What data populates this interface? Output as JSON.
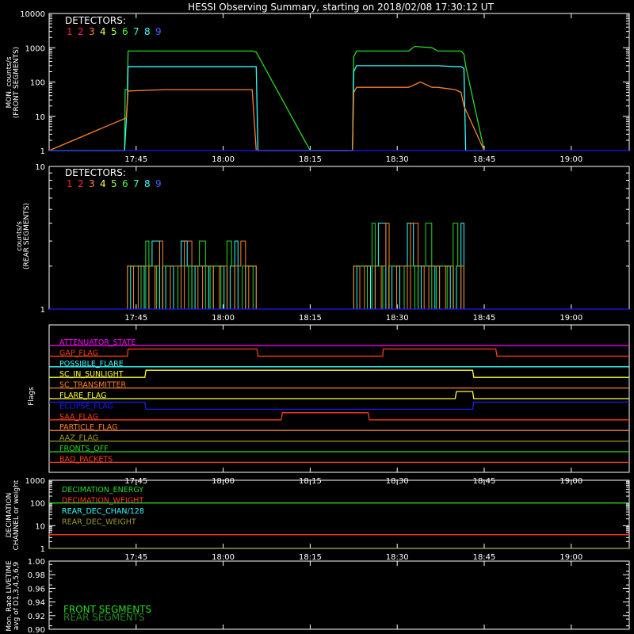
{
  "title": "HESSI Observing Summary, starting on 2018/02/08 17:30:12 UT",
  "time_ticks": [
    "17:45",
    "18:00",
    "18:15",
    "18:30",
    "18:45",
    "19:00"
  ],
  "detector_digits": [
    "1",
    "2",
    "3",
    "4",
    "5",
    "6",
    "7",
    "8",
    "9"
  ],
  "colors": {
    "det": [
      "#ff2020",
      "#ff2060",
      "#ff8040",
      "#ffff40",
      "#a0ff40",
      "#40ff40",
      "#40ffc0",
      "#40ffff",
      "#4060ff"
    ],
    "green": "#22dd22",
    "cyan": "#33ffff",
    "orange": "#ff7f2a",
    "blue": "#1a1aff",
    "magenta": "#ff00ff",
    "red": "#ff3a1a",
    "yellow": "#ffff2a",
    "olive": "#9a9a2a",
    "dkgreen": "#228822",
    "white": "#ffffff"
  },
  "panel1": {
    "ylabel": "MON. counts/s",
    "ylabel2": "(FRONT SEGMENTS)",
    "legend_title": "DETECTORS:",
    "yticks": [
      "1",
      "10",
      "100",
      "1000",
      "10000"
    ]
  },
  "panel2": {
    "ylabel": "counts/s",
    "ylabel2": "(REAR SEGMENTS)",
    "legend_title": "DETECTORS:",
    "yticks": [
      "1",
      "10"
    ]
  },
  "panel3": {
    "ylabel": "Flags",
    "flags": [
      "ATTENUATOR_STATE",
      "GAP_FLAG",
      "POSSIBLE_FLARE",
      "SC_IN_SUNLIGHT",
      "SC_TRANSMITTER",
      "FLARE_FLAG",
      "ECLIPSE_FLAG",
      "SAA_FLAG",
      "PARTICLE_FLAG",
      "AAZ_FLAG",
      "FRONTS_OFF",
      "BAD_PACKETS"
    ]
  },
  "panel4": {
    "ylabel": "DECIMATION",
    "ylabel2": "CHANNEL or weight",
    "yticks": [
      "1",
      "10",
      "100",
      "1000"
    ],
    "legend": [
      "DECIMATION_ENERGY",
      "DECIMATION_WEIGHT",
      "REAR_DEC_CHAN/128",
      "REAR_DEC_WEIGHT"
    ]
  },
  "panel5": {
    "ylabel": "Mon. Rate LIVETIME",
    "ylabel2": "avg of D1,3,4,5,6,9",
    "yticks": [
      "0.90",
      "0.92",
      "0.94",
      "0.96",
      "0.98",
      "1.00"
    ],
    "legend": [
      "FRONT SEGMENTS",
      "REAR SEGMENTS"
    ]
  },
  "chart_data": [
    {
      "type": "line",
      "title": "HESSI Observing Summary, starting on 2018/02/08 17:30:12 UT",
      "ylabel": "MON. counts/s (FRONT SEGMENTS)",
      "yscale": "log",
      "ylim": [
        1,
        10000
      ],
      "x_unit": "minutes after 17:30 UT",
      "xlim": [
        0,
        100
      ],
      "series": [
        {
          "color": "green",
          "x": [
            0,
            13,
            13.1,
            13.5,
            13.6,
            35,
            35.7,
            45,
            46,
            52.3,
            52.5,
            53,
            60,
            62,
            63,
            66,
            67,
            71,
            71.5,
            71.8,
            75
          ],
          "y": [
            1,
            1,
            60,
            60,
            800,
            800,
            750,
            1,
            1,
            1,
            550,
            800,
            800,
            800,
            1100,
            1000,
            800,
            800,
            650,
            300,
            1
          ]
        },
        {
          "color": "cyan",
          "x": [
            0,
            13,
            13.5,
            13.6,
            35,
            35.7,
            36,
            46,
            52.3,
            52.5,
            53,
            66,
            67,
            70,
            71,
            71.5,
            71.8,
            75
          ],
          "y": [
            1,
            1,
            30,
            280,
            280,
            280,
            1,
            1,
            1,
            200,
            300,
            300,
            300,
            280,
            280,
            250,
            1,
            1
          ]
        },
        {
          "color": "orange",
          "x": [
            0,
            13.3,
            13.6,
            14,
            20,
            26,
            30,
            35,
            35.7,
            46,
            52.3,
            52.5,
            53,
            56,
            62,
            64,
            66,
            67,
            70,
            71,
            71.5,
            75
          ],
          "y": [
            1,
            9,
            55,
            55,
            60,
            60,
            60,
            60,
            1,
            1,
            1,
            50,
            70,
            70,
            70,
            100,
            70,
            70,
            60,
            50,
            20,
            1
          ]
        },
        {
          "color": "blue",
          "x": [
            0,
            100
          ],
          "y": [
            1,
            1
          ]
        }
      ]
    },
    {
      "type": "line",
      "ylabel": "counts/s (REAR SEGMENTS)",
      "yscale": "log",
      "ylim": [
        1,
        10
      ],
      "x_unit": "minutes after 17:30 UT",
      "xlim": [
        0,
        100
      ],
      "series": [
        {
          "color": "cyan",
          "x": [
            0,
            13.5,
            13.6,
            35,
            35.7,
            52.5,
            52.7,
            71.5,
            72,
            100
          ],
          "y": [
            1,
            1,
            2,
            3,
            1,
            1,
            4,
            3,
            1,
            1
          ]
        },
        {
          "color": "green",
          "x": [
            0,
            14,
            14.1,
            34,
            35,
            52.7,
            53,
            70,
            71,
            100
          ],
          "y": [
            1,
            1,
            2,
            2,
            1,
            1,
            3,
            2,
            1,
            1
          ]
        },
        {
          "color": "orange",
          "x": [
            0,
            14,
            14.1,
            34,
            35,
            52.7,
            53,
            70,
            71,
            100
          ],
          "y": [
            1,
            1,
            2,
            2,
            1,
            1,
            3,
            2,
            1,
            1
          ]
        }
      ]
    },
    {
      "type": "line",
      "ylabel": "Flags",
      "x_unit": "minutes after 17:30 UT",
      "xlim": [
        0,
        100
      ],
      "series": [
        {
          "name": "ATTENUATOR_STATE",
          "color": "magenta",
          "x": [
            0,
            100
          ],
          "y": [
            0,
            0
          ]
        },
        {
          "name": "GAP_FLAG",
          "color": "red",
          "x": [
            0,
            13.5,
            13.6,
            35.8,
            36,
            57.5,
            57.6,
            77,
            77.2,
            100
          ],
          "y": [
            0,
            0,
            1,
            1,
            0,
            0,
            1,
            1,
            0,
            0
          ]
        },
        {
          "name": "POSSIBLE_FLARE",
          "color": "cyan",
          "x": [
            0,
            100
          ],
          "y": [
            0,
            0
          ]
        },
        {
          "name": "SC_IN_SUNLIGHT",
          "color": "yellow",
          "x": [
            0,
            16.5,
            16.7,
            73,
            73.2,
            100
          ],
          "y": [
            0,
            0,
            1,
            1,
            0,
            0
          ]
        },
        {
          "name": "SC_TRANSMITTER",
          "color": "orange",
          "x": [
            0,
            100
          ],
          "y": [
            0,
            0
          ]
        },
        {
          "name": "FLARE_FLAG",
          "color": "yellow",
          "x": [
            0,
            70,
            70.2,
            73,
            73.2,
            100
          ],
          "y": [
            0,
            0,
            1,
            1,
            0,
            0
          ]
        },
        {
          "name": "ECLIPSE_FLAG",
          "color": "blue",
          "x": [
            0,
            16.5,
            16.7,
            73,
            73.2,
            100
          ],
          "y": [
            1,
            1,
            0,
            0,
            1,
            1
          ]
        },
        {
          "name": "SAA_FLAG",
          "color": "red",
          "x": [
            0,
            40,
            40.2,
            55,
            55.2,
            100
          ],
          "y": [
            0,
            0,
            1,
            1,
            0,
            0
          ]
        },
        {
          "name": "PARTICLE_FLAG",
          "color": "orange",
          "x": [
            0,
            100
          ],
          "y": [
            0,
            0
          ]
        },
        {
          "name": "AAZ_FLAG",
          "color": "olive",
          "x": [
            0,
            100
          ],
          "y": [
            0,
            0
          ]
        },
        {
          "name": "FRONTS_OFF",
          "color": "green",
          "x": [
            0,
            100
          ],
          "y": [
            0,
            0
          ]
        },
        {
          "name": "BAD_PACKETS",
          "color": "red",
          "x": [
            0,
            100
          ],
          "y": [
            0,
            0
          ]
        }
      ]
    },
    {
      "type": "line",
      "ylabel": "DECIMATION CHANNEL or weight",
      "yscale": "log",
      "ylim": [
        1,
        1000
      ],
      "x_unit": "minutes after 17:30 UT",
      "xlim": [
        0,
        100
      ],
      "series": [
        {
          "name": "DECIMATION_ENERGY",
          "color": "green",
          "x": [
            0,
            100
          ],
          "y": [
            100,
            100
          ]
        },
        {
          "name": "DECIMATION_WEIGHT",
          "color": "red",
          "x": [
            0,
            100
          ],
          "y": [
            4,
            4
          ]
        },
        {
          "name": "REAR_DEC_CHAN/128",
          "color": "cyan",
          "x": [
            0,
            100
          ],
          "y": [
            1,
            1
          ]
        },
        {
          "name": "REAR_DEC_WEIGHT",
          "color": "olive",
          "x": [
            0,
            100
          ],
          "y": [
            1,
            1
          ]
        }
      ]
    },
    {
      "type": "line",
      "ylabel": "Mon. Rate LIVETIME avg of D1,3,4,5,6,9",
      "ylim": [
        0.9,
        1.0
      ],
      "x_unit": "minutes after 17:30 UT",
      "xlim": [
        0,
        100
      ],
      "series": [
        {
          "name": "FRONT SEGMENTS",
          "color": "green",
          "x": [],
          "y": []
        },
        {
          "name": "REAR SEGMENTS",
          "color": "dkgreen",
          "x": [],
          "y": []
        }
      ]
    }
  ]
}
